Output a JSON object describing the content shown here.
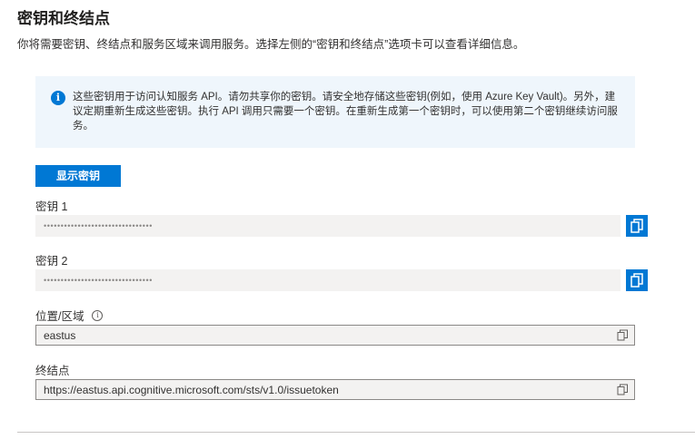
{
  "header": {
    "title": "密钥和终结点",
    "subtitle": "你将需要密钥、终结点和服务区域来调用服务。选择左侧的“密钥和终结点”选项卡可以查看详细信息。"
  },
  "info": {
    "icon": "info-icon",
    "text": "这些密钥用于访问认知服务 API。请勿共享你的密钥。请安全地存储这些密钥(例如，使用 Azure Key Vault)。另外，建议定期重新生成这些密钥。执行 API 调用只需要一个密钥。在重新生成第一个密钥时，可以使用第二个密钥继续访问服务。"
  },
  "actions": {
    "show_keys_label": "显示密钥"
  },
  "fields": {
    "key1": {
      "label": "密钥 1",
      "mask": "••••••••••••••••••••••••••••••••"
    },
    "key2": {
      "label": "密钥 2",
      "mask": "••••••••••••••••••••••••••••••••"
    },
    "location": {
      "label": "位置/区域",
      "value": "eastus"
    },
    "endpoint": {
      "label": "终结点",
      "value": "https://eastus.api.cognitive.microsoft.com/sts/v1.0/issuetoken"
    }
  },
  "colors": {
    "accent": "#0078d4",
    "info_bg": "#eff6fc",
    "field_bg": "#f3f2f1"
  }
}
